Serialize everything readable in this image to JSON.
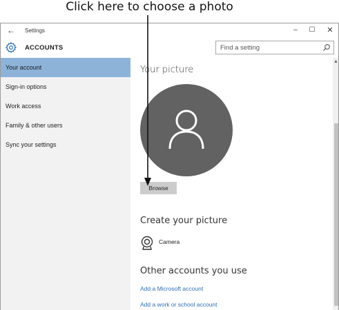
{
  "caption": "Click here to choose a photo",
  "window": {
    "title": "Settings",
    "back_glyph": "←",
    "controls": {
      "minimize": "–",
      "maximize": "☐",
      "close": "✕"
    }
  },
  "header": {
    "section_title": "ACCOUNTS",
    "search_placeholder": "Find a setting"
  },
  "sidebar": {
    "items": [
      {
        "label": "Your account",
        "active": true
      },
      {
        "label": "Sign-in options",
        "active": false
      },
      {
        "label": "Work access",
        "active": false
      },
      {
        "label": "Family & other users",
        "active": false
      },
      {
        "label": "Sync your settings",
        "active": false
      }
    ]
  },
  "content": {
    "your_picture": "Your picture",
    "browse_label": "Browse",
    "create_picture": "Create your picture",
    "camera_label": "Camera",
    "other_accounts": "Other accounts you use",
    "links": {
      "microsoft": "Add a Microsoft account",
      "work": "Add a work or school account"
    }
  },
  "colors": {
    "sidebar_active": "#8db3d9",
    "sidebar_bg": "#f2f2f2",
    "avatar_bg": "#626262",
    "link": "#2e6fb8",
    "button_bg": "#cccccc"
  },
  "icons": [
    "back-arrow-icon",
    "gear-icon",
    "search-icon",
    "user-silhouette-icon",
    "camera-icon"
  ]
}
